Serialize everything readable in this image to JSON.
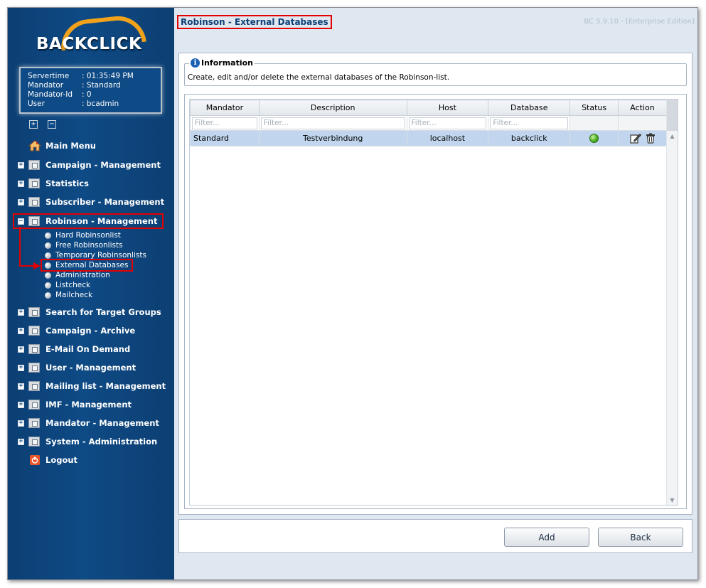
{
  "brand": {
    "logo_text": "BACKCLICK"
  },
  "server_info": {
    "rows": [
      {
        "label": "Servertime",
        "value": ": 01:35:49 PM"
      },
      {
        "label": "Mandator",
        "value": ": Standard"
      },
      {
        "label": "Mandator-Id",
        "value": ": 0"
      },
      {
        "label": "User",
        "value": ": bcadmin"
      }
    ]
  },
  "tree_toggles": {
    "expand": "+",
    "collapse": "−"
  },
  "nav": {
    "main_menu": "Main Menu",
    "campaign_management": "Campaign - Management",
    "statistics": "Statistics",
    "subscriber_management": "Subscriber - Management",
    "robinson_management": "Robinson - Management",
    "robinson_items": [
      "Hard Robinsonlist",
      "Free Robinsonlists",
      "Temporary Robinsonlists",
      "External Databases",
      "Administration",
      "Listcheck",
      "Mailcheck"
    ],
    "search_target_groups": "Search for Target Groups",
    "campaign_archive": "Campaign - Archive",
    "email_on_demand": "E-Mail On Demand",
    "user_management": "User - Management",
    "mailing_list_management": "Mailing list - Management",
    "imf_management": "IMF - Management",
    "mandator_management": "Mandator - Management",
    "system_administration": "System - Administration",
    "logout": "Logout"
  },
  "header": {
    "title": "Robinson - External Databases",
    "version": "BC 5.9.10 - [Enterprise Edition]"
  },
  "information": {
    "legend": "Information",
    "text": "Create, edit and/or delete the external databases of the Robinson-list."
  },
  "grid": {
    "columns": [
      "Mandator",
      "Description",
      "Host",
      "Database",
      "Status",
      "Action"
    ],
    "filter_placeholder": "Filter...",
    "rows": [
      {
        "mandator": "Standard",
        "description": "Testverbindung",
        "host": "localhost",
        "database": "backclick",
        "status": "active"
      }
    ]
  },
  "buttons": {
    "add": "Add",
    "back": "Back"
  },
  "colors": {
    "sidebar": "#0e4a85",
    "accent": "#f2a21a",
    "highlight": "#e30000",
    "selected_row": "#c1d6ee"
  }
}
